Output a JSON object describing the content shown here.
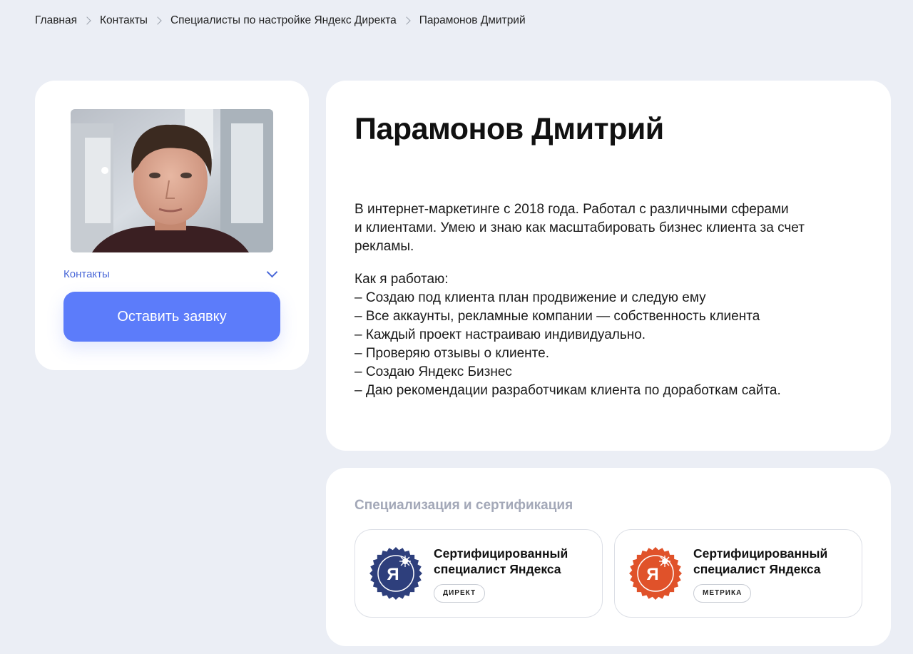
{
  "breadcrumb": {
    "items": [
      "Главная",
      "Контакты",
      "Специалисты по настройке Яндекс Директа",
      "Парамонов Дмитрий"
    ]
  },
  "profile": {
    "contacts_label": "Контакты",
    "apply_button": "Оставить заявку"
  },
  "bio": {
    "name": "Парамонов Дмитрий",
    "intro_lines": [
      "В интернет-маркетинге с 2018 года. Работал с различными сферами",
      "и клиентами. Умею и знаю как масштабировать бизнес клиента за счет",
      "рекламы."
    ],
    "how_lines": [
      "Как я работаю:",
      "– Создаю под клиента план продвижение и следую ему",
      "– Все аккаунты, рекламные компании — собственность клиента",
      "– Каждый проект настраиваю индивидуально.",
      "– Проверяю отзывы о клиенте.",
      "– Создаю Яндекс Бизнес",
      "– Даю рекомендации разработчикам клиента по доработкам сайта."
    ]
  },
  "specialization": {
    "title": "Специализация и сертификация",
    "certificates": [
      {
        "name_line1": "Сертифицированный",
        "name_line2": "специалист Яндекса",
        "tag": "ДИРЕКТ",
        "seal_letter": "Я",
        "color": "#2e3f7c",
        "icon": "direct-seal-icon"
      },
      {
        "name_line1": "Сертифицированный",
        "name_line2": "специалист Яндекса",
        "tag": "МЕТРИКА",
        "seal_letter": "Я",
        "color": "#e0522a",
        "icon": "metrika-seal-icon"
      }
    ]
  },
  "colors": {
    "background": "#ebeef5",
    "accent": "#5c7cfa",
    "link": "#4a68d8",
    "muted_title": "#a3a8b8"
  }
}
